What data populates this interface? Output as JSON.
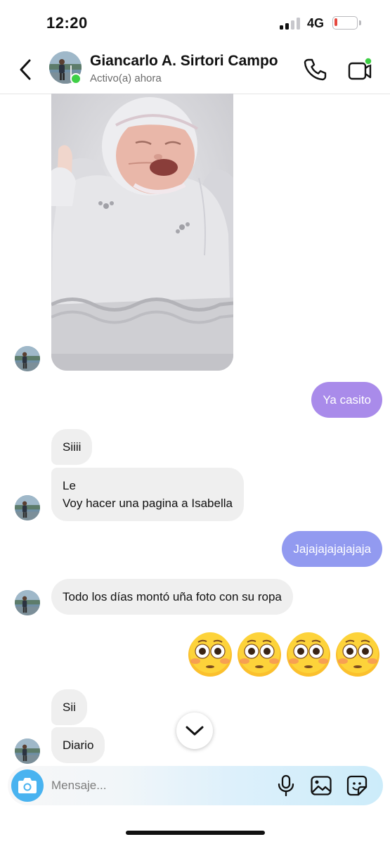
{
  "status_bar": {
    "time": "12:20",
    "network": "4G",
    "battery_level": 0.08,
    "battery_color": "#e5483f",
    "signal_bars_active": 2
  },
  "header": {
    "contact_name": "Giancarlo A. Sirtori Campo",
    "status": "Activo(a) ahora",
    "online_color": "#3ecf45",
    "icons": [
      "back-chevron-icon",
      "phone-icon",
      "video-camera-icon"
    ]
  },
  "conversation": {
    "photo_message": {
      "icon": "newborn-photo-image"
    },
    "messages": [
      {
        "id": "m1",
        "direction": "out",
        "text": "Ya casito"
      },
      {
        "id": "m2",
        "direction": "in",
        "text": "Siiii"
      },
      {
        "id": "m3",
        "direction": "in",
        "line1": "Le",
        "line2": "Voy hacer una pagina a Isabella"
      },
      {
        "id": "m4",
        "direction": "out",
        "text": "Jajajajajajajaja"
      },
      {
        "id": "m5",
        "direction": "in",
        "text": "Todo los días montó uña foto con su ropa"
      },
      {
        "id": "m6",
        "direction": "out",
        "emoji_count": 4,
        "emoji": "flushed-face-emoji"
      },
      {
        "id": "m7",
        "direction": "in",
        "text": "Sii"
      },
      {
        "id": "m8",
        "direction": "in",
        "text": "Diario"
      }
    ],
    "outgoing_colors": [
      "#a98bea",
      "#9c93ee",
      "#8f9af0"
    ]
  },
  "composer": {
    "placeholder": "Mensaje...",
    "value": "",
    "camera_color": "#49b3f0",
    "icons": [
      "camera-icon",
      "microphone-icon",
      "gallery-icon",
      "sticker-icon"
    ]
  }
}
